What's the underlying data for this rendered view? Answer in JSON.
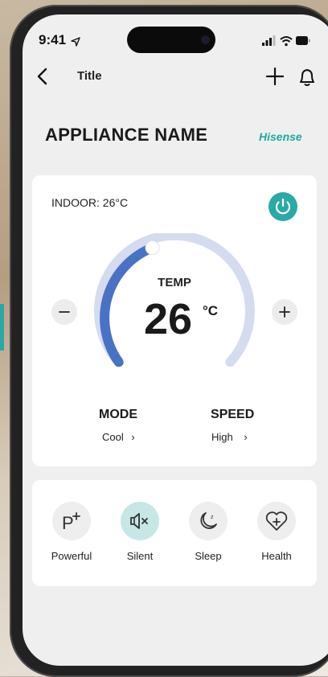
{
  "status_bar": {
    "time": "9:41"
  },
  "header": {
    "title": "Title"
  },
  "appliance": {
    "name": "APPLIANCE NAME",
    "brand": "Hisense"
  },
  "control": {
    "indoor_label": "INDOOR: 26°C",
    "temp_label": "TEMP",
    "temp_value": "26",
    "temp_unit": "°C",
    "minus_symbol": "−",
    "plus_symbol": "+",
    "mode": {
      "label": "MODE",
      "value": "Cool"
    },
    "speed": {
      "label": "SPEED",
      "value": "High"
    },
    "chevron": "›"
  },
  "features": [
    {
      "label": "Powerful",
      "icon": "power-boost-icon",
      "active": false
    },
    {
      "label": "Silent",
      "icon": "speaker-mute-icon",
      "active": true
    },
    {
      "label": "Sleep",
      "icon": "moon-icon",
      "active": false
    },
    {
      "label": "Health",
      "icon": "heart-plus-icon",
      "active": false
    }
  ],
  "colors": {
    "accent": "#2aaaa6",
    "dial_active": "#4a72c4",
    "dial_track": "#d5dcf0",
    "active_feature": "#c6e7e6"
  }
}
